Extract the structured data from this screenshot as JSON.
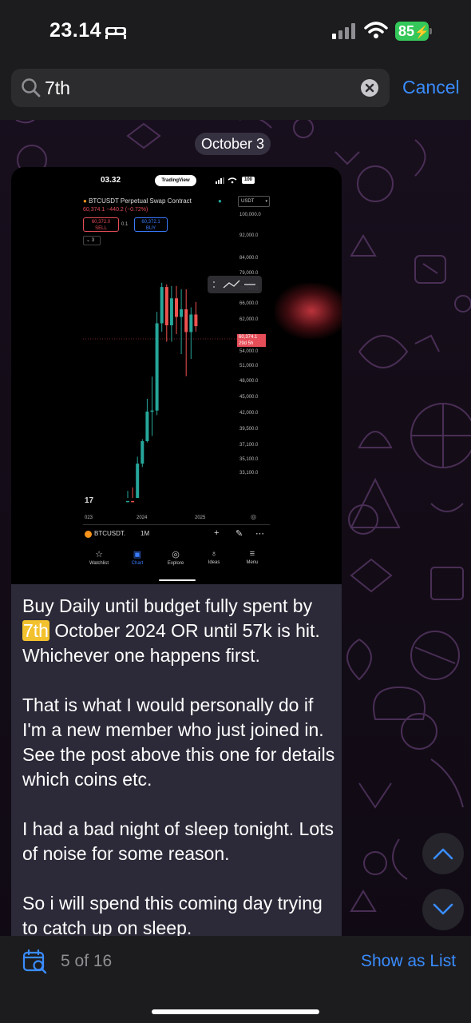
{
  "status_bar": {
    "time": "23.14",
    "battery": "85"
  },
  "search": {
    "query": "7th",
    "cancel_label": "Cancel"
  },
  "date_badge": "October 3",
  "message": {
    "line1_before": "Buy Daily until budget fully spent by",
    "highlight": "7th",
    "line1_after": " October 2024 OR until 57k is hit. Whichever one happens first.",
    "paragraph2": "That is what I would personally do if I'm a new member who just joined in. See the post above this one for details which coins etc.",
    "paragraph3": "I had a bad night of sleep tonight. Lots of noise for some reason.",
    "paragraph4": "So i will spend this coming day trying to catch up on sleep."
  },
  "screenshot": {
    "time": "03.32",
    "brand": "TradingView",
    "battery": "100",
    "symbol_title": "BTCUSDT Perpetual Swap Contract",
    "price_line": "60,374.1 −440.2 (−0.72%)",
    "sell_price": "60,372.0",
    "sell_label": "SELL",
    "buy_price": "60,372.1",
    "buy_label": "BUY",
    "spread": "0.1",
    "indicator_count": "3",
    "currency": "USDT",
    "price_tag": "60,374.1",
    "price_tag_sub": "29d 5h",
    "ticker": "BTCUSDT.",
    "timeframe": "1M",
    "tv_logo": "17",
    "nav": [
      {
        "label": "Watchlist",
        "icon": "star-icon"
      },
      {
        "label": "Chart",
        "icon": "chart-icon"
      },
      {
        "label": "Explore",
        "icon": "compass-icon"
      },
      {
        "label": "Ideas",
        "icon": "bulb-icon"
      },
      {
        "label": "Menu",
        "icon": "menu-icon"
      }
    ]
  },
  "chart_data": {
    "type": "bar",
    "title": "BTCUSDT Perpetual Swap Contract",
    "y_ticks": [
      "100,000.0",
      "92,000.0",
      "84,000.0",
      "79,000.0",
      "70,000.0",
      "66,000.0",
      "62,000.0",
      "54,000.0",
      "51,000.0",
      "48,000.0",
      "45,000.0",
      "42,000.0",
      "39,500.0",
      "37,100.0",
      "35,100.0",
      "33,100.0"
    ],
    "x_ticks": [
      "023",
      "2024",
      "2025"
    ],
    "candles": [
      {
        "o": 26000,
        "c": 29000,
        "h": 30500,
        "l": 25000
      },
      {
        "o": 29000,
        "c": 27000,
        "h": 31000,
        "l": 26000
      },
      {
        "o": 27000,
        "c": 34500,
        "h": 35500,
        "l": 26800
      },
      {
        "o": 34500,
        "c": 37700,
        "h": 38000,
        "l": 34000
      },
      {
        "o": 37700,
        "c": 42300,
        "h": 44700,
        "l": 37500
      },
      {
        "o": 42300,
        "c": 42500,
        "h": 48900,
        "l": 38500
      },
      {
        "o": 42500,
        "c": 61100,
        "h": 64000,
        "l": 41700
      },
      {
        "o": 61100,
        "c": 71300,
        "h": 73700,
        "l": 59000
      },
      {
        "o": 71300,
        "c": 60600,
        "h": 72800,
        "l": 56500
      },
      {
        "o": 60600,
        "c": 67500,
        "h": 71900,
        "l": 56500
      },
      {
        "o": 67500,
        "c": 62700,
        "h": 71900,
        "l": 58400
      },
      {
        "o": 62700,
        "c": 64600,
        "h": 70000,
        "l": 53500
      },
      {
        "o": 64600,
        "c": 58900,
        "h": 70000,
        "l": 49000
      },
      {
        "o": 58900,
        "c": 63300,
        "h": 65100,
        "l": 52500
      },
      {
        "o": 63300,
        "c": 60374,
        "h": 66500,
        "l": 59000
      }
    ],
    "up_color": "#26a69a",
    "down_color": "#ef5350"
  },
  "bottom_bar": {
    "match_count": "5 of 16",
    "show_list_label": "Show as List"
  },
  "colors": {
    "accent": "#3a8cff",
    "highlight": "#f2c12e",
    "battery": "#34c759"
  }
}
